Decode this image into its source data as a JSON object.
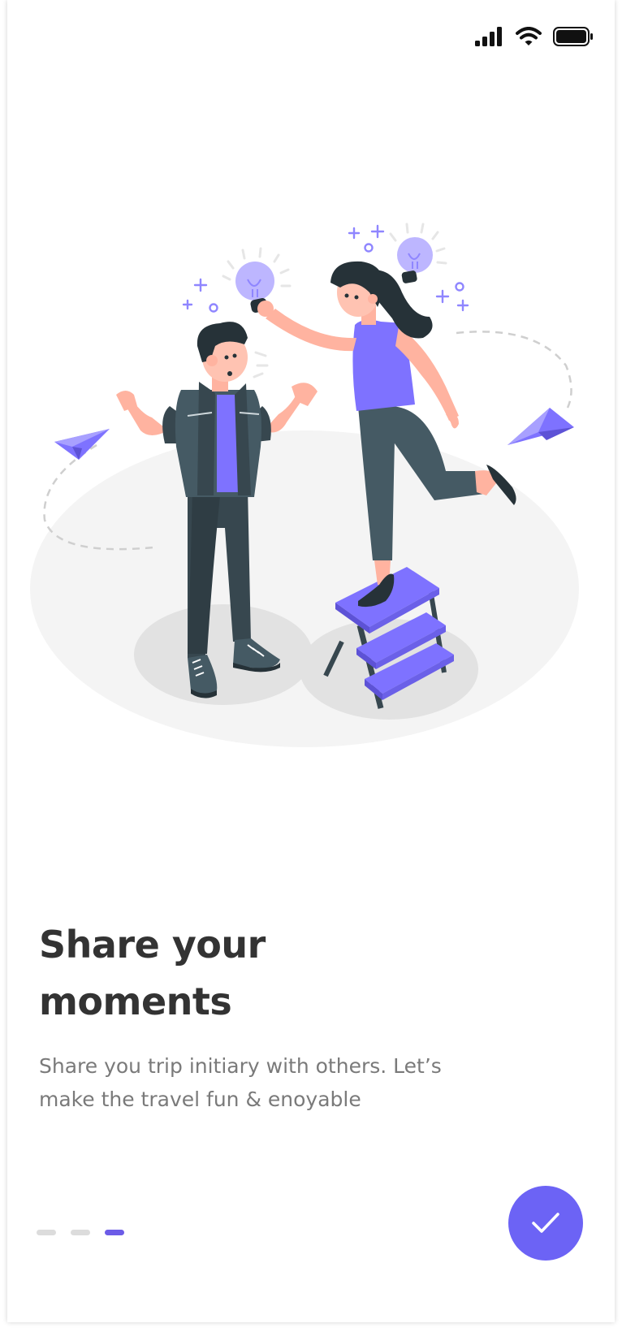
{
  "status_bar": {
    "icons": [
      "signal-icon",
      "wifi-icon",
      "battery-icon"
    ]
  },
  "illustration": {
    "name": "idea-sharing-illustration"
  },
  "onboarding": {
    "title": "Share your moments",
    "subtitle": "Share you trip initiary with others. Let’s make the travel fun & enoyable"
  },
  "pager": {
    "total": 3,
    "current": 3
  },
  "fab": {
    "icon": "check-icon"
  },
  "colors": {
    "accent": "#6C63F5",
    "title": "#333333",
    "subtitle": "#7A7A7A",
    "dot_inactive": "#DCDCDC"
  }
}
